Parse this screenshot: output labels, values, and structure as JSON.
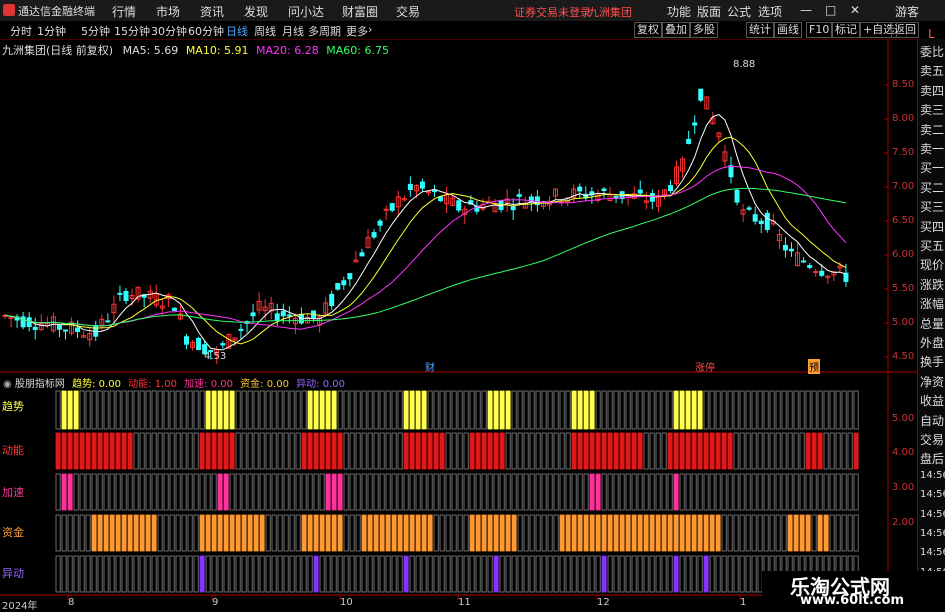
{
  "menubar": {
    "app_title": "通达信金融终端",
    "menus": [
      "行情",
      "市场",
      "资讯",
      "发现",
      "问小达",
      "财富圈",
      "交易"
    ],
    "notice": "证券交易未登录",
    "stock": "九洲集团",
    "right": [
      "功能",
      "版面",
      "公式",
      "选项"
    ],
    "user": "游客"
  },
  "toolbar": {
    "periods": [
      "分时",
      "1分钟",
      "5分钟",
      "15分钟",
      "30分钟",
      "60分钟",
      "日线",
      "周线",
      "月线",
      "多周期",
      "更多"
    ],
    "active_period": "日线",
    "right_buttons": [
      "复权",
      "叠加",
      "多股",
      "统计",
      "画线",
      "F10",
      "标记",
      "+自选",
      "返回"
    ]
  },
  "chart_header": {
    "title": "九洲集团(日线 前复权)",
    "ma5": "MA5: 5.69",
    "ma10": "MA10: 5.91",
    "ma20": "MA20: 6.28",
    "ma60": "MA60: 6.75"
  },
  "price_axis_ticks": [
    "8.50",
    "8.00",
    "7.50",
    "7.00",
    "6.50",
    "6.00",
    "5.50",
    "5.00",
    "4.50"
  ],
  "annotations": {
    "high": "8.88",
    "low": "4.53",
    "tag1": "财",
    "tag2": "涨停",
    "tag3": "预"
  },
  "indicator": {
    "name": "股朋指标网",
    "values": [
      {
        "label": "趋势",
        "value": "0.00",
        "color": "#ffff33"
      },
      {
        "label": "动能",
        "value": "1.00",
        "color": "#ff3333"
      },
      {
        "label": "加速",
        "value": "0.00",
        "color": "#ff3399"
      },
      {
        "label": "资金",
        "value": "0.00",
        "color": "#ffcc33"
      },
      {
        "label": "异动",
        "value": "0.00",
        "color": "#9966ff"
      }
    ],
    "rows": [
      {
        "label": "趋势",
        "color": "#ffff4d"
      },
      {
        "label": "动能",
        "color": "#e01818"
      },
      {
        "label": "加速",
        "color": "#ff3399"
      },
      {
        "label": "资金",
        "color": "#ff9933"
      },
      {
        "label": "异动",
        "color": "#8833ff"
      }
    ],
    "axis": [
      "5.00",
      "4.00",
      "3.00",
      "2.00"
    ]
  },
  "date_axis": [
    "2024年",
    "8",
    "9",
    "10",
    "11",
    "12",
    "1"
  ],
  "sidebar": {
    "top": "L",
    "items": [
      "委比",
      "卖五",
      "卖四",
      "卖三",
      "卖二",
      "卖一",
      "买一",
      "买二",
      "买三",
      "买四",
      "买五",
      "现价",
      "涨跌",
      "涨幅",
      "总量",
      "外盘",
      "换手",
      "净资",
      "收益",
      "自动",
      "交易",
      "盘后",
      "14:56",
      "14:56",
      "14:56",
      "14:56",
      "14:56",
      "14:56",
      "14:56"
    ]
  },
  "watermark": {
    "line1": "乐淘公式网",
    "line2": "www.60lt.com"
  }
}
